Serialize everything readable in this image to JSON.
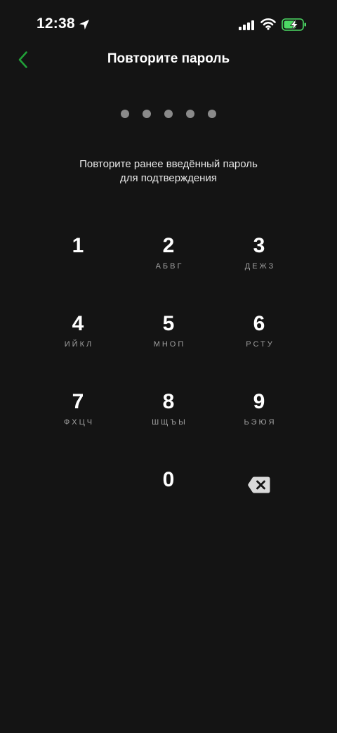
{
  "status_bar": {
    "time": "12:38",
    "icons": [
      "location-arrow-icon",
      "signal-icon",
      "wifi-icon",
      "battery-charging-icon"
    ],
    "battery_color": "#4cd964"
  },
  "header": {
    "title": "Повторите пароль",
    "back_icon": "chevron-left-icon",
    "accent_color": "#21a038"
  },
  "pin": {
    "length": 5,
    "filled": 0,
    "dot_color": "#8a8a8a"
  },
  "description": {
    "line1": "Повторите ранее введённый пароль",
    "line2": "для подтверждения"
  },
  "keypad": {
    "keys": [
      {
        "digit": "1",
        "letters": ""
      },
      {
        "digit": "2",
        "letters": "АБВГ"
      },
      {
        "digit": "3",
        "letters": "ДЕЖЗ"
      },
      {
        "digit": "4",
        "letters": "ИЙКЛ"
      },
      {
        "digit": "5",
        "letters": "МНОП"
      },
      {
        "digit": "6",
        "letters": "РСТУ"
      },
      {
        "digit": "7",
        "letters": "ФХЦЧ"
      },
      {
        "digit": "8",
        "letters": "ШЩЪЫ"
      },
      {
        "digit": "9",
        "letters": "ЬЭЮЯ"
      },
      {
        "digit": "0",
        "letters": ""
      }
    ],
    "backspace_icon": "backspace-icon"
  }
}
